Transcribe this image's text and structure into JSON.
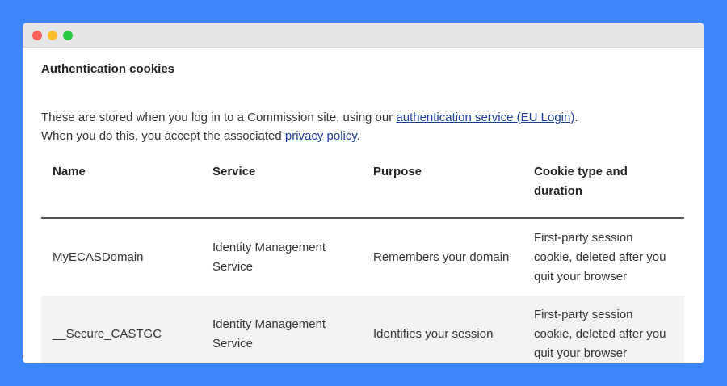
{
  "window": {
    "controls": [
      "close",
      "minimize",
      "maximize"
    ],
    "colors": {
      "close": "#fe5f57",
      "minimize": "#febc2e",
      "maximize": "#28c840"
    }
  },
  "section": {
    "title": "Authentication cookies",
    "intro_line1_prefix": "These are stored when you log in to a Commission site, using our ",
    "intro_line1_link": "authentication service (EU Login)",
    "intro_line1_suffix": ".",
    "intro_line2_prefix": "When you do this, you accept the associated ",
    "intro_line2_link": "privacy policy",
    "intro_line2_suffix": "."
  },
  "table": {
    "headers": [
      "Name",
      "Service",
      "Purpose",
      "Cookie type and duration"
    ],
    "rows": [
      [
        "MyECASDomain",
        "Identity Management Service",
        "Remembers your domain",
        "First-party session cookie, deleted after you quit your browser"
      ],
      [
        "__Secure_CASTGC",
        "Identity Management Service",
        "Identifies your session",
        "First-party session cookie, deleted after you quit your browser"
      ]
    ]
  },
  "colors": {
    "background": "#3d86f8",
    "link": "#1a3d9a",
    "row_shade": "#f2f2f2"
  }
}
